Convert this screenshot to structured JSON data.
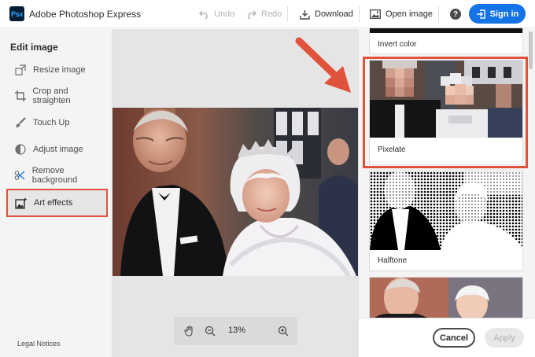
{
  "app": {
    "title": "Adobe Photoshop Express",
    "logo_text": "Psx"
  },
  "toolbar": {
    "undo_label": "Undo",
    "redo_label": "Redo",
    "download_label": "Download",
    "open_image_label": "Open image",
    "help_glyph": "?",
    "sign_in_label": "Sign in"
  },
  "sidebar": {
    "heading": "Edit image",
    "items": [
      {
        "label": "Resize image",
        "icon": "resize-icon"
      },
      {
        "label": "Crop and straighten",
        "icon": "crop-icon"
      },
      {
        "label": "Touch Up",
        "icon": "brush-icon"
      },
      {
        "label": "Adjust image",
        "icon": "adjust-icon"
      },
      {
        "label": "Remove background",
        "icon": "remove-bg-icon"
      },
      {
        "label": "Art effects",
        "icon": "art-effects-icon",
        "active": true
      }
    ],
    "legal": "Legal Notices"
  },
  "canvas": {
    "zoom": "13%"
  },
  "effects": [
    {
      "label": "Invert color"
    },
    {
      "label": "Pixelate",
      "selected": true
    },
    {
      "label": "Halftone"
    },
    {
      "label": ""
    }
  ],
  "footer": {
    "cancel_label": "Cancel",
    "apply_label": "Apply"
  },
  "colors": {
    "accent": "#1473e6",
    "highlight": "#e0523c",
    "sidebar_bg": "#f4f4f4",
    "canvas_bg": "#e5e5e5"
  }
}
